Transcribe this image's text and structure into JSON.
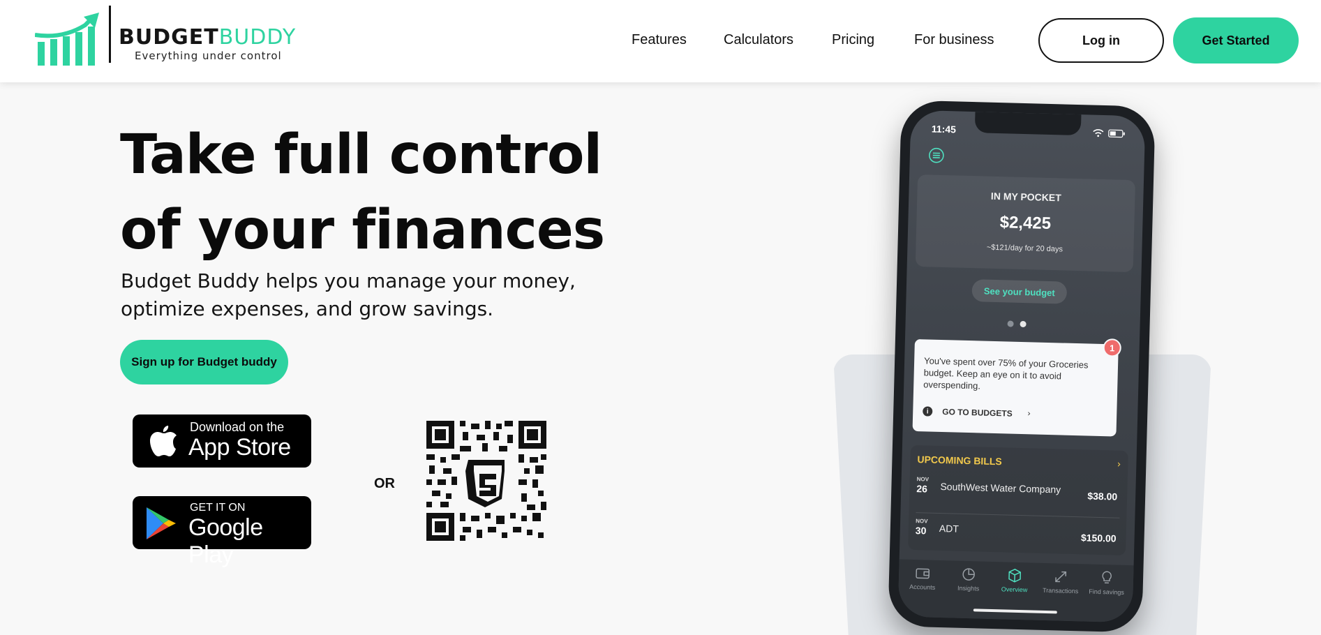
{
  "brand": {
    "name_part1": "BUDGET",
    "name_part2": "BUDDY",
    "tagline": "Everything under control",
    "accent_color": "#2ed3a0"
  },
  "nav": {
    "items": [
      "Features",
      "Calculators",
      "Pricing",
      "For business"
    ],
    "login_label": "Log in",
    "get_started_label": "Get Started"
  },
  "hero": {
    "title_line1": "Take full control",
    "title_line2": "of your finances",
    "subtitle_line1": "Budget Buddy helps you manage your money,",
    "subtitle_line2": "optimize expenses, and grow savings.",
    "signup_label": "Sign up for Budget buddy"
  },
  "stores": {
    "appstore_small": "Download on the",
    "appstore_big": "App Store",
    "gplay_small": "GET IT ON",
    "gplay_big": "Google Play",
    "or_label": "OR"
  },
  "phone": {
    "time": "11:45",
    "pocket_title": "IN MY POCKET",
    "pocket_amount": "$2,425",
    "pocket_daily": "~$121/day for 20 days",
    "see_budget_label": "See your budget",
    "alert_text": "You've spent over 75% of your Groceries budget. Keep an eye on it to avoid overspending.",
    "alert_badge": "1",
    "alert_link": "GO TO BUDGETS",
    "bills_title": "UPCOMING BILLS",
    "bills": [
      {
        "month": "NOV",
        "day": "26",
        "name": "SouthWest Water Company",
        "amount": "$38.00"
      },
      {
        "month": "NOV",
        "day": "30",
        "name": "ADT",
        "amount": "$150.00"
      }
    ],
    "tabs": [
      {
        "label": "Accounts",
        "icon": "wallet-icon"
      },
      {
        "label": "Insights",
        "icon": "pie-chart-icon"
      },
      {
        "label": "Overview",
        "icon": "cube-icon"
      },
      {
        "label": "Transactions",
        "icon": "arrows-icon"
      },
      {
        "label": "Find savings",
        "icon": "lightbulb-icon"
      }
    ]
  }
}
